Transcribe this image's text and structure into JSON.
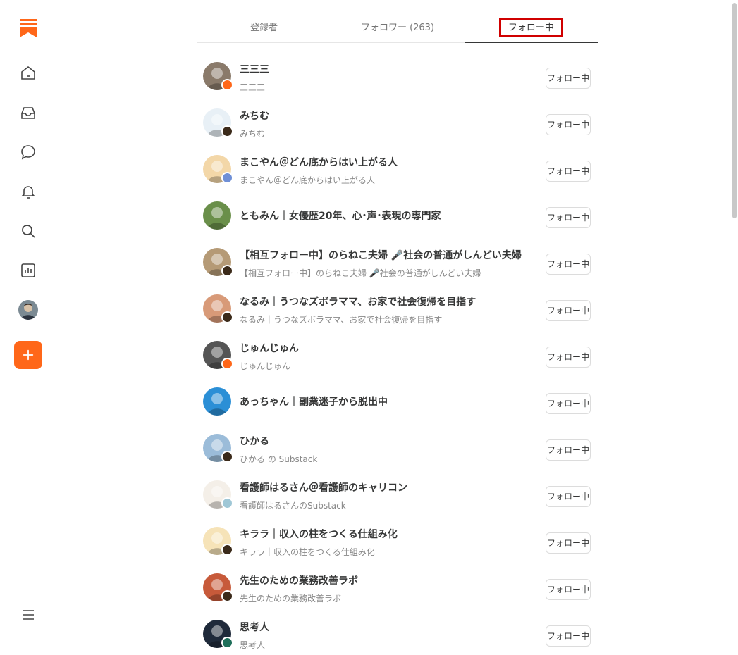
{
  "tabs": [
    {
      "label": "登録者",
      "active": false
    },
    {
      "label": "フォロワー (263)",
      "active": false
    },
    {
      "label": "フォロー中",
      "active": true
    }
  ],
  "button_label": "フォロー中",
  "colors": {
    "accent": "#ff6719",
    "highlight": "#d00000"
  },
  "sidebar": {
    "icons": [
      "substack-logo-icon",
      "home-icon",
      "inbox-icon",
      "chat-icon",
      "bell-icon",
      "search-icon",
      "stats-icon",
      "profile-avatar",
      "create-plus-icon",
      "menu-icon"
    ]
  },
  "following": [
    {
      "name": "三三三",
      "sub": "三三三",
      "avatar": "#8a7a6a",
      "badge": "#ff6719"
    },
    {
      "name": "みちむ",
      "sub": "みちむ",
      "avatar": "#e8f0f6",
      "badge": "#3b2a1a"
    },
    {
      "name": "まこやん＠どん底からはい上がる人",
      "sub": "まこやん＠どん底からはい上がる人",
      "avatar": "#f3d7a8",
      "badge": "#6f8fd6"
    },
    {
      "name": "ともみん｜女優歴20年、心･声･表現の専門家",
      "sub": "",
      "avatar": "#6a8f4a",
      "badge": ""
    },
    {
      "name": "【相互フォロー中】のらねこ夫婦 🎤社会の普通がしんどい夫婦",
      "sub": "【相互フォロー中】のらねこ夫婦 🎤社会の普通がしんどい夫婦",
      "avatar": "#b59a76",
      "badge": "#3b2a1a"
    },
    {
      "name": "なるみ｜うつなズボラママ、お家で社会復帰を目指す",
      "sub": "なるみ｜うつなズボラママ、お家で社会復帰を目指す",
      "avatar": "#d89a78",
      "badge": "#3b2a1a"
    },
    {
      "name": "じゅんじゅん",
      "sub": "じゅんじゅん",
      "avatar": "#555555",
      "badge": "#ff6719"
    },
    {
      "name": "あっちゃん｜副業迷子から脱出中",
      "sub": "",
      "avatar": "#2b8fd6",
      "badge": ""
    },
    {
      "name": "ひかる",
      "sub": "ひかる の Substack",
      "avatar": "#9bbcd9",
      "badge": "#3b2a1a"
    },
    {
      "name": "看護師はるさん＠看護師のキャリコン",
      "sub": "看護師はるさんのSubstack",
      "avatar": "#f4efe8",
      "badge": "#9fc7d6"
    },
    {
      "name": "キララ｜収入の柱をつくる仕組み化",
      "sub": "キララ｜収入の柱をつくる仕組み化",
      "avatar": "#f6e3b8",
      "badge": "#3b2a1a"
    },
    {
      "name": "先生のための業務改善ラボ",
      "sub": "先生のための業務改善ラボ",
      "avatar": "#c75a3a",
      "badge": "#3b2a1a"
    },
    {
      "name": "思考人",
      "sub": "思考人",
      "avatar": "#1f2a3a",
      "badge": "#1f6f5a"
    }
  ]
}
